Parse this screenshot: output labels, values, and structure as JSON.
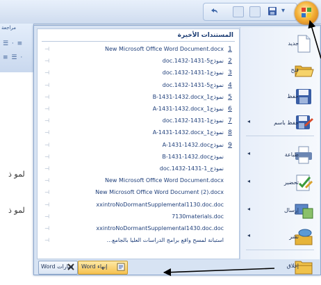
{
  "ribbon": {
    "tab_label": "مراجعة",
    "row1": "☰ · ≡",
    "row2": "≡ ☰ ·"
  },
  "background_text": [
    "لمو ذ",
    "لمو ذ"
  ],
  "quick_access": {
    "items": [
      "undo-icon",
      "redo-icon",
      "save-icon",
      "print-icon"
    ]
  },
  "office_button": {
    "icon": "office-logo-icon"
  },
  "recent": {
    "title": "المستندات الأخيرة",
    "items": [
      {
        "num": "1",
        "name": "New Microsoft Office Word Document.docx"
      },
      {
        "num": "2",
        "name": "doc.1432-1431-5نموذج"
      },
      {
        "num": "3",
        "name": "doc.1432-1431-1نموذج"
      },
      {
        "num": "4",
        "name": "doc.1432-1431-5نموذج"
      },
      {
        "num": "5",
        "name": "B-1431-1432.docx_1نموذج"
      },
      {
        "num": "6",
        "name": "A-1431-1432.docx_1نموذج"
      },
      {
        "num": "7",
        "name": "doc.1432-1431-1نموذج"
      },
      {
        "num": "8",
        "name": "A-1431-1432.docx_1نموذج"
      },
      {
        "num": "9",
        "name": "A-1431-1432.docنموذج"
      },
      {
        "num": "",
        "name": "B-1431-1432.docنموذج"
      },
      {
        "num": "",
        "name": "doc.1432-1431-1_نموذج"
      },
      {
        "num": "",
        "name": "New Microsoft Office Word Document.docx"
      },
      {
        "num": "",
        "name": "New Microsoft Office Word Document (2).docx"
      },
      {
        "num": "",
        "name": "xxintroNoDormantSupplemental1130.doc.doc"
      },
      {
        "num": "",
        "name": "7130materials.doc"
      },
      {
        "num": "",
        "name": "xxintroNoDormantSupplemental1430.doc.doc"
      },
      {
        "num": "",
        "name": "...استبانة لمسح واقع برامج الدراسات العليا بالجامع"
      }
    ]
  },
  "commands": [
    {
      "id": "new",
      "label": "جديد",
      "icon": "new-document-icon",
      "submenu": false
    },
    {
      "id": "open",
      "label": "فتح",
      "icon": "open-folder-icon",
      "submenu": false
    },
    {
      "id": "save",
      "label": "حفظ",
      "icon": "save-icon",
      "submenu": false
    },
    {
      "id": "save-as",
      "label": "حفظ باسم",
      "icon": "save-as-icon",
      "submenu": true
    },
    {
      "id": "print",
      "label": "طباعة",
      "icon": "printer-icon",
      "submenu": true
    },
    {
      "id": "prepare",
      "label": "تحضير",
      "icon": "prepare-icon",
      "submenu": true
    },
    {
      "id": "send",
      "label": "إرسال",
      "icon": "send-icon",
      "submenu": true
    },
    {
      "id": "publish",
      "label": "نشر",
      "icon": "publish-icon",
      "submenu": true
    },
    {
      "id": "close",
      "label": "إغلاق",
      "icon": "close-folder-icon",
      "submenu": false
    }
  ],
  "bottom": {
    "options_label": "Word خيارات",
    "exit_label": "Word إنهاء"
  },
  "colors": {
    "accent": "#f6c14f",
    "menu_bg": "#d7e3f3",
    "link": "#1f3f7a"
  }
}
